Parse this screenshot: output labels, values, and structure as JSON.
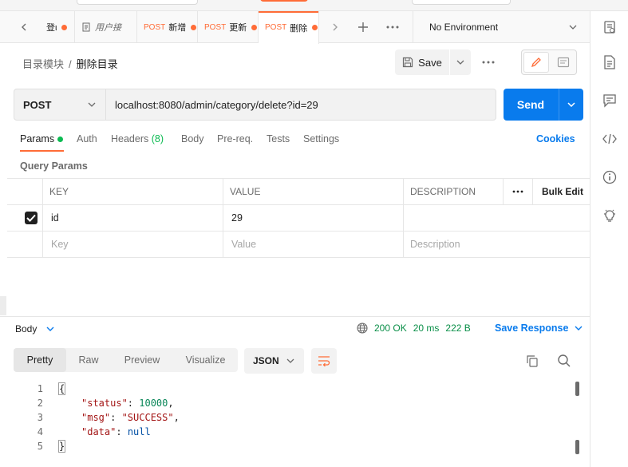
{
  "tabs": [
    {
      "method": "",
      "label": "登ι"
    },
    {
      "method": "",
      "label": "用户接"
    },
    {
      "method": "POST",
      "label": "新增"
    },
    {
      "method": "POST",
      "label": "更新"
    },
    {
      "method": "POST",
      "label": "删除"
    }
  ],
  "environment": "No Environment",
  "breadcrumb": {
    "parent": "目录模块",
    "separator": "/",
    "current": "删除目录"
  },
  "toolbar": {
    "save_label": "Save"
  },
  "request": {
    "method": "POST",
    "url": "localhost:8080/admin/category/delete?id=29",
    "send_label": "Send"
  },
  "request_tabs": {
    "params": "Params",
    "auth": "Auth",
    "headers": "Headers",
    "headers_count": "(8)",
    "body": "Body",
    "prereq": "Pre-req.",
    "tests": "Tests",
    "settings": "Settings",
    "cookies": "Cookies"
  },
  "query_params": {
    "label": "Query Params",
    "columns": {
      "key": "KEY",
      "value": "VALUE",
      "description": "DESCRIPTION",
      "bulk_edit": "Bulk Edit"
    },
    "rows": [
      {
        "key": "id",
        "value": "29",
        "description": "",
        "checked": true
      }
    ],
    "placeholders": {
      "key": "Key",
      "value": "Value",
      "description": "Description"
    }
  },
  "response": {
    "body_label": "Body",
    "status": "200 OK",
    "time": "20 ms",
    "size": "222 B",
    "save_label": "Save Response",
    "views": [
      "Pretty",
      "Raw",
      "Preview",
      "Visualize"
    ],
    "language": "JSON",
    "line_numbers": [
      "1",
      "2",
      "3",
      "4",
      "5"
    ],
    "json": {
      "open": "{",
      "close": "}",
      "status_key": "\"status\"",
      "status_val": "10000",
      "msg_key": "\"msg\"",
      "msg_val": "\"SUCCESS\"",
      "data_key": "\"data\"",
      "data_val": "null"
    }
  },
  "colors": {
    "accent": "#ff6c37",
    "primary": "#097bed",
    "success": "#0cbb52"
  }
}
